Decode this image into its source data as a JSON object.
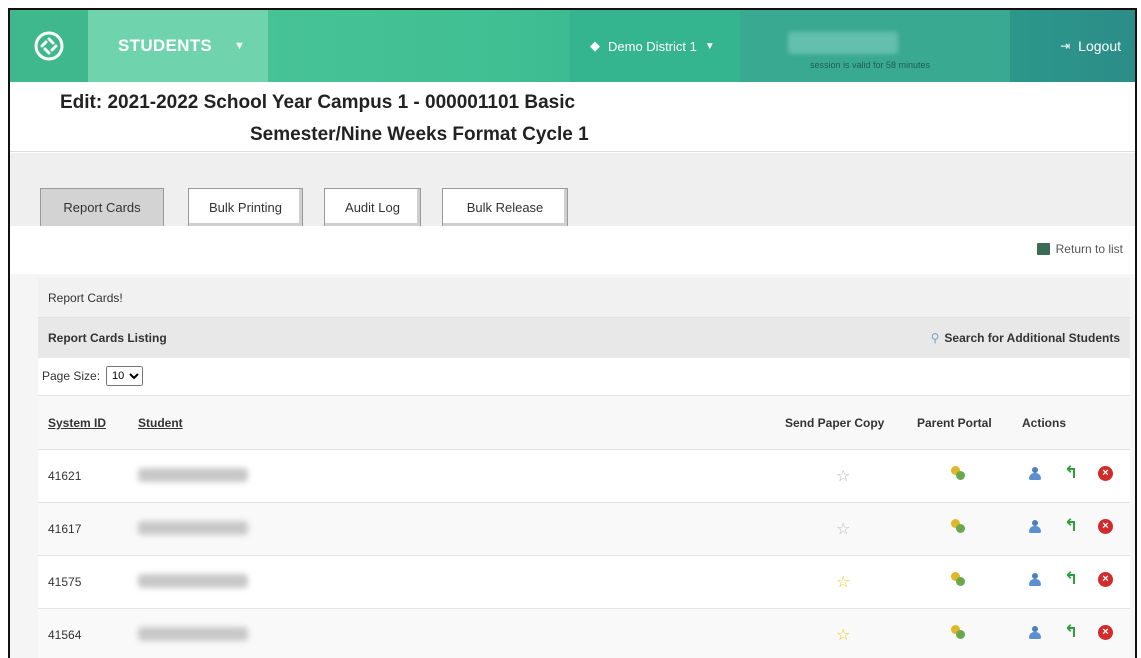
{
  "header": {
    "module": "STUDENTS",
    "district": "Demo District 1",
    "session_text": "session is valid for 58 minutes",
    "logout": "Logout"
  },
  "page": {
    "title_line1": "Edit: 2021-2022 School Year Campus 1 - 000001101 Basic",
    "title_line2": "Semester/Nine Weeks Format Cycle 1"
  },
  "tabs": [
    {
      "label": "Report Cards",
      "active": true
    },
    {
      "label": "Bulk Printing",
      "active": false
    },
    {
      "label": "Audit Log",
      "active": false
    },
    {
      "label": "Bulk Release",
      "active": false
    }
  ],
  "return_link": "Return to list",
  "panel": {
    "title": "Report Cards!",
    "listing_title": "Report Cards Listing",
    "search_link": "Search for Additional Students",
    "page_size_label": "Page Size:",
    "page_size_value": "10"
  },
  "table": {
    "columns": {
      "system_id": "System ID",
      "student": "Student",
      "send_paper_copy": "Send Paper Copy",
      "parent_portal": "Parent Portal",
      "actions": "Actions"
    },
    "rows": [
      {
        "system_id": "41621",
        "send_paper_copy": false
      },
      {
        "system_id": "41617",
        "send_paper_copy": false
      },
      {
        "system_id": "41575",
        "send_paper_copy": true
      },
      {
        "system_id": "41564",
        "send_paper_copy": true
      }
    ]
  },
  "colors": {
    "topbar": "#3fbf93",
    "module_cell": "#6fd4ad",
    "star_on": "#e6c820",
    "star_off": "#b8b8b8",
    "delete": "#d22b2b",
    "undo": "#2e9e3a"
  }
}
